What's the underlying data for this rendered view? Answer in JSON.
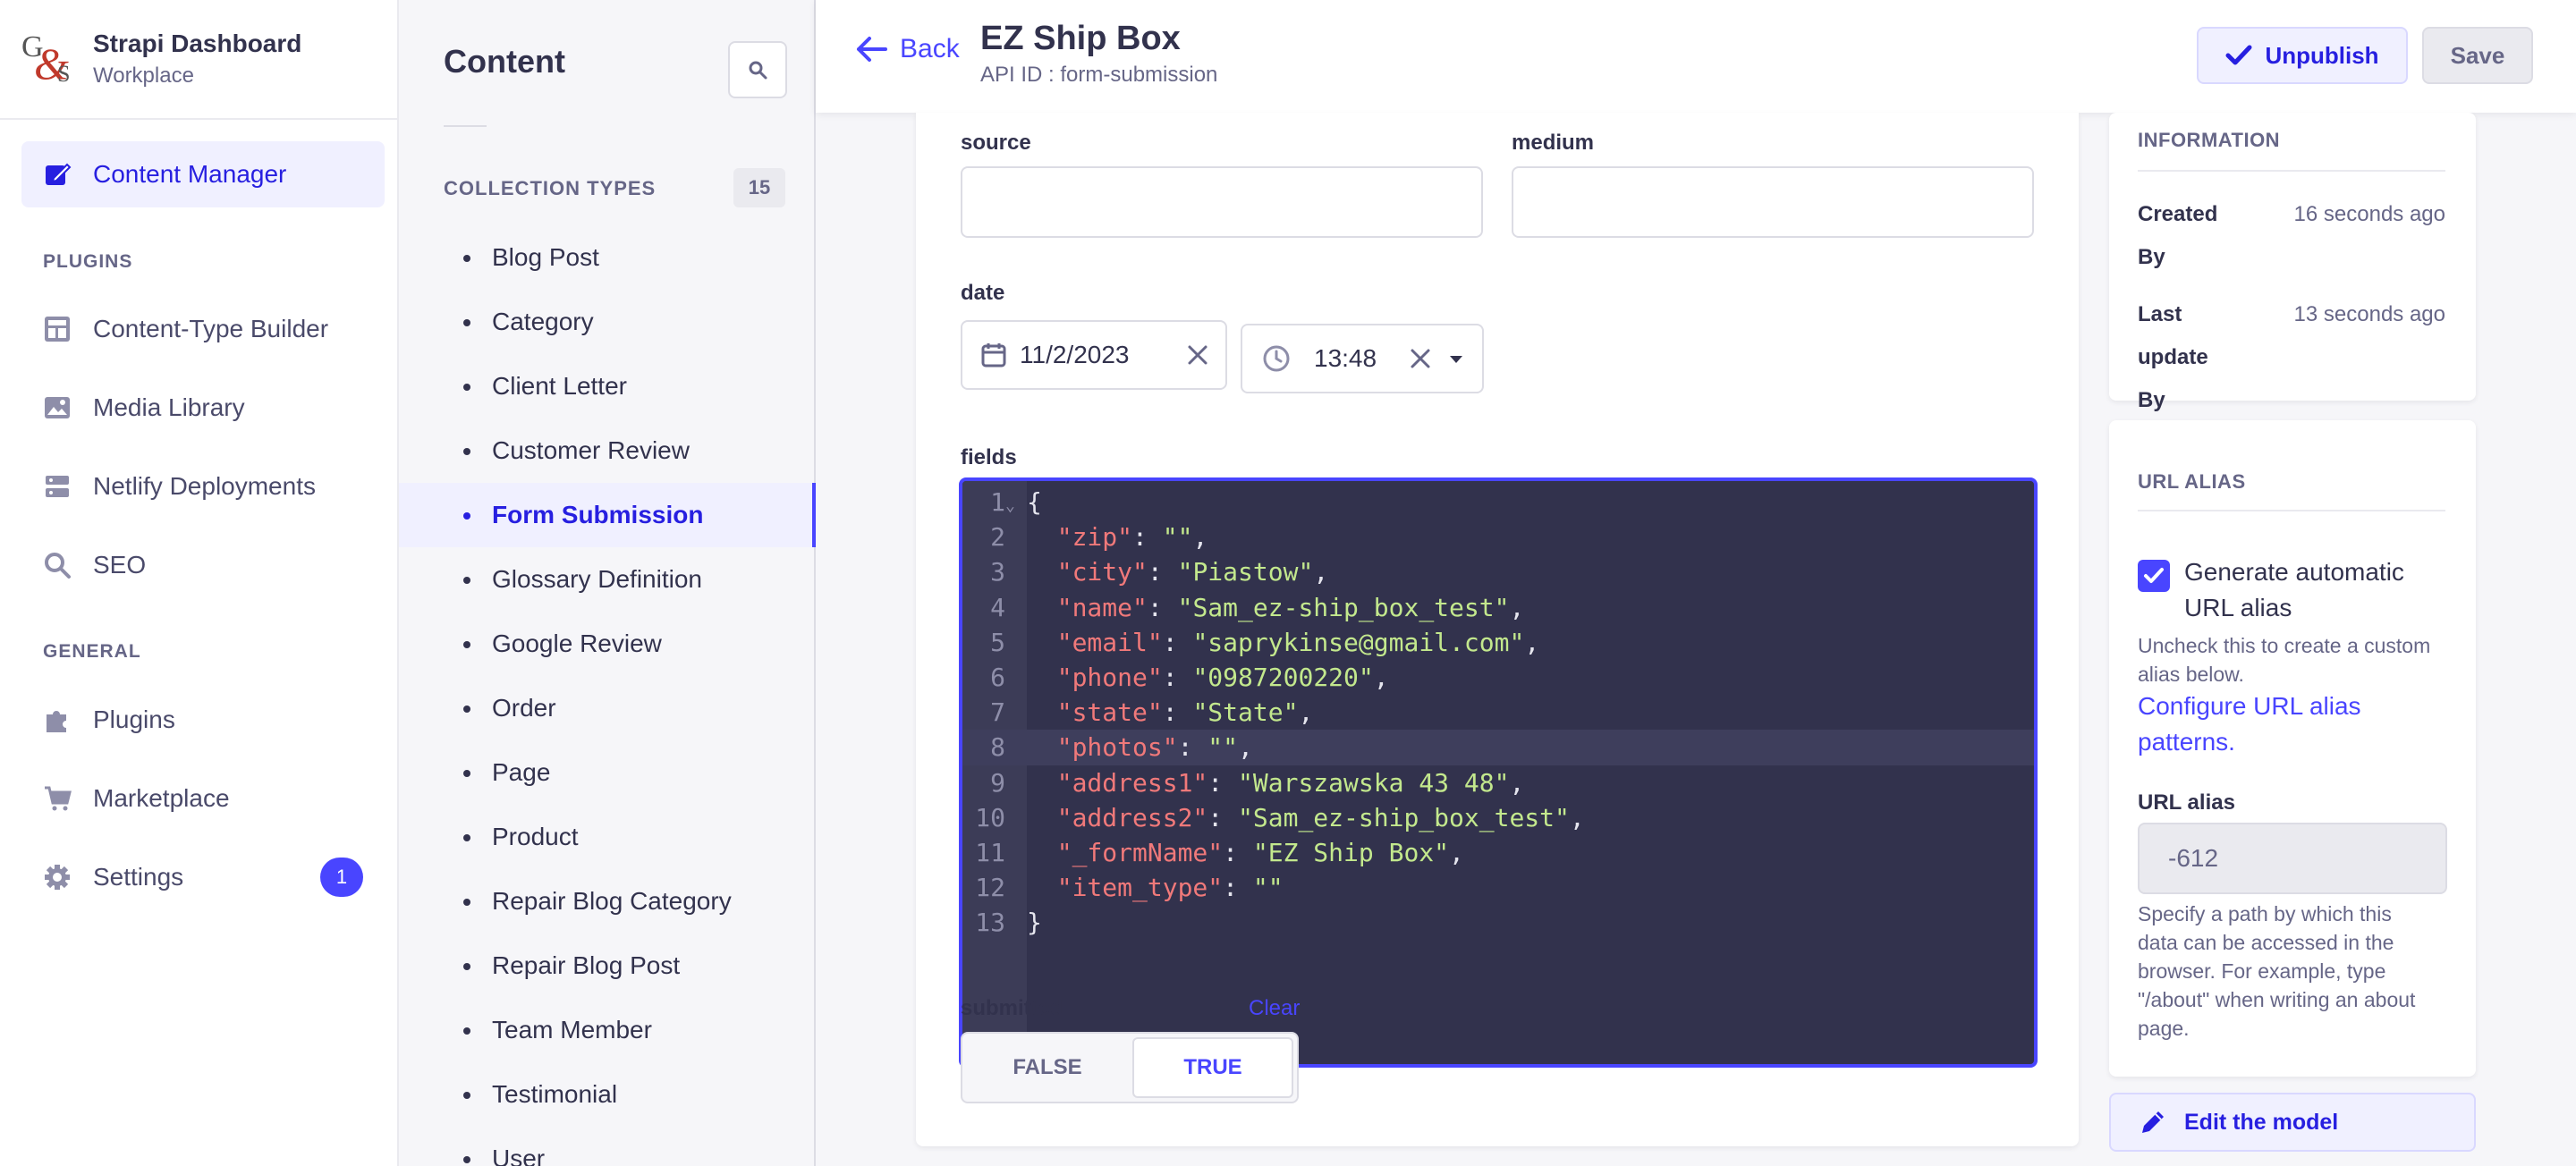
{
  "brand": {
    "title": "Strapi Dashboard",
    "subtitle": "Workplace",
    "logo_g": "G",
    "logo_amp": "&",
    "logo_s": "S"
  },
  "main_nav": {
    "content_manager": "Content Manager",
    "plugins_section": "PLUGINS",
    "plugins": [
      "Content-Type Builder",
      "Media Library",
      "Netlify Deployments",
      "SEO"
    ],
    "general_section": "GENERAL",
    "general": [
      "Plugins",
      "Marketplace",
      "Settings"
    ],
    "settings_badge": "1"
  },
  "sub_nav": {
    "title": "Content",
    "collection_types_label": "COLLECTION TYPES",
    "collection_types_count": "15",
    "items": [
      "Blog Post",
      "Category",
      "Client Letter",
      "Customer Review",
      "Form Submission",
      "Glossary Definition",
      "Google Review",
      "Order",
      "Page",
      "Product",
      "Repair Blog Category",
      "Repair Blog Post",
      "Team Member",
      "Testimonial",
      "User"
    ],
    "active_index": 4
  },
  "header": {
    "back_label": "Back",
    "title": "EZ Ship Box",
    "api_id": "API ID : form-submission",
    "unpublish_label": "Unpublish",
    "save_label": "Save"
  },
  "form": {
    "source_label": "source",
    "source_value": "",
    "medium_label": "medium",
    "medium_value": "",
    "date_label": "date",
    "date_value": "11/2/2023",
    "time_value": "13:48",
    "fields_label": "fields",
    "code_lines": [
      {
        "n": "1",
        "fold": true,
        "k": "",
        "v": "",
        "raw": "{"
      },
      {
        "n": "2",
        "k": "\"zip\"",
        "v": "\"\"",
        "end": ","
      },
      {
        "n": "3",
        "k": "\"city\"",
        "v": "\"Piastow\"",
        "end": ","
      },
      {
        "n": "4",
        "k": "\"name\"",
        "v": "\"Sam_ez-ship_box_test\"",
        "end": ","
      },
      {
        "n": "5",
        "k": "\"email\"",
        "v": "\"saprykinse@gmail.com\"",
        "end": ","
      },
      {
        "n": "6",
        "k": "\"phone\"",
        "v": "\"0987200220\"",
        "end": ","
      },
      {
        "n": "7",
        "k": "\"state\"",
        "v": "\"State\"",
        "end": ","
      },
      {
        "n": "8",
        "k": "\"photos\"",
        "v": "\"\"",
        "end": ",",
        "highlight": true
      },
      {
        "n": "9",
        "k": "\"address1\"",
        "v": "\"Warszawska 43 48\"",
        "end": ","
      },
      {
        "n": "10",
        "k": "\"address2\"",
        "v": "\"Sam_ez-ship_box_test\"",
        "end": ","
      },
      {
        "n": "11",
        "k": "\"_formName\"",
        "v": "\"EZ Ship Box\"",
        "end": ","
      },
      {
        "n": "12",
        "k": "\"item_type\"",
        "v": "\"\"",
        "end": ""
      },
      {
        "n": "13",
        "k": "",
        "v": "",
        "raw": "}"
      }
    ],
    "submitted_label": "submitted",
    "clear_label": "Clear",
    "false_label": "FALSE",
    "true_label": "TRUE",
    "submitted_value": "TRUE"
  },
  "information": {
    "heading": "INFORMATION",
    "created_label": "Created By",
    "created_value": "16 seconds ago",
    "updated_label": "Last update By",
    "updated_value": "13 seconds ago"
  },
  "url_alias": {
    "heading": "URL ALIAS",
    "checkbox_label": "Generate automatic URL alias",
    "checked": true,
    "uncheck_hint": "Uncheck this to create a custom alias below.",
    "configure_link": "Configure URL alias patterns.",
    "field_label": "URL alias",
    "field_value": "-612",
    "field_hint": "Specify a path by which this data can be accessed in the browser. For example, type \"/about\" when writing an about page."
  },
  "edit_model_label": "Edit the model",
  "colors": {
    "primary": "#4945ff",
    "primary_dark": "#271fe0",
    "code_bg": "#32324d",
    "code_key": "#f0797a",
    "code_value": "#c3e88d"
  }
}
